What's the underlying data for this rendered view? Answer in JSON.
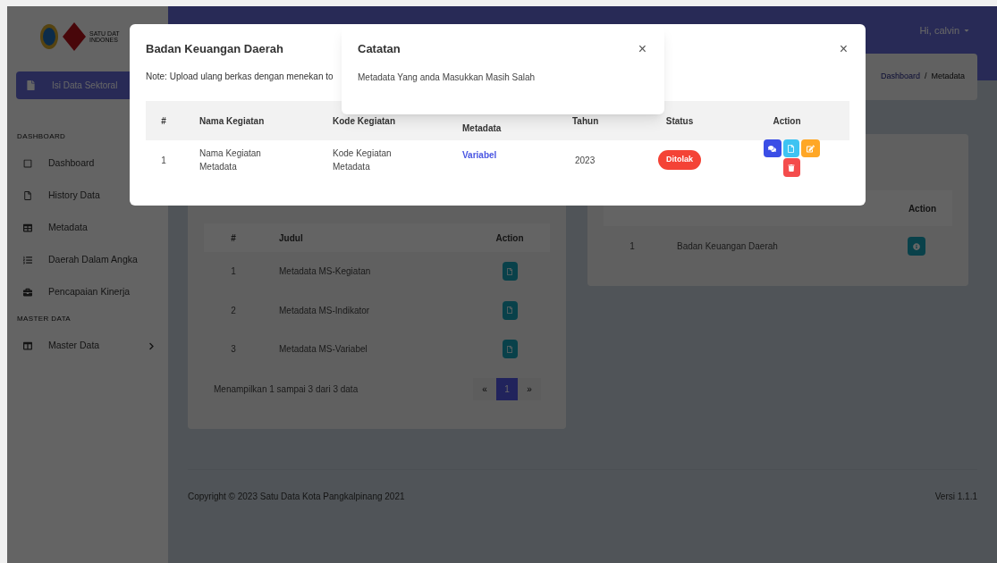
{
  "sidebar": {
    "logo_text": [
      "SATU DAT",
      "INDONES"
    ],
    "button": "Isi Data Sektoral",
    "sections": [
      {
        "heading": "DASHBOARD",
        "items": [
          {
            "label": "Dashboard",
            "expandable": false
          },
          {
            "label": "History Data",
            "expandable": false
          },
          {
            "label": "Metadata",
            "expandable": false
          },
          {
            "label": "Daerah Dalam Angka",
            "expandable": false
          },
          {
            "label": "Pencapaian Kinerja",
            "expandable": false
          }
        ]
      },
      {
        "heading": "MASTER DATA",
        "items": [
          {
            "label": "Master Data",
            "expandable": true
          }
        ]
      }
    ]
  },
  "topbar": {
    "user_menu": "Hi, calvin"
  },
  "breadcrumb": {
    "items": [
      "Dashboard",
      "Metadata"
    ],
    "separator": "/"
  },
  "metadata_table": {
    "columns": [
      "#",
      "Judul",
      "Action"
    ],
    "rows": [
      {
        "no": "1",
        "title": "Metadata MS-Kegiatan"
      },
      {
        "no": "2",
        "title": "Metadata MS-Indikator"
      },
      {
        "no": "3",
        "title": "Metadata MS-Variabel"
      }
    ],
    "summary": "Menampilkan 1 sampai 3 dari 3 data",
    "pagination": {
      "prev": "«",
      "pages": [
        {
          "label": "1",
          "selected": true
        }
      ],
      "next": "»"
    }
  },
  "opd_table": {
    "columns": [
      "Action"
    ],
    "rows": [
      {
        "no": "1",
        "name": "Badan Keuangan Daerah"
      }
    ]
  },
  "footer": {
    "copyright": "Copyright © 2023 Satu Data Kota Pangkalpinang 2021",
    "version": "Versi 1.1.1"
  },
  "modal": {
    "title": "Badan Keuangan Daerah",
    "close": "×",
    "note": "Note: Upload ulang berkas dengan menekan to",
    "columns": [
      "#",
      "Nama Kegiatan",
      "Kode Kegiatan",
      "Metadata",
      "Tahun",
      "Status",
      "Action"
    ],
    "rows": [
      {
        "no": "1",
        "nama": "Nama Kegiatan Metadata",
        "kode": "Kode Kegiatan Metadata",
        "kategori": "Variabel",
        "tahun": "2023",
        "status": {
          "label": "Ditolak",
          "kind": "rejected"
        }
      }
    ]
  },
  "notes_modal": {
    "title": "Catatan",
    "close": "×",
    "body": "Metadata Yang anda Masukkan Masih Salah"
  }
}
